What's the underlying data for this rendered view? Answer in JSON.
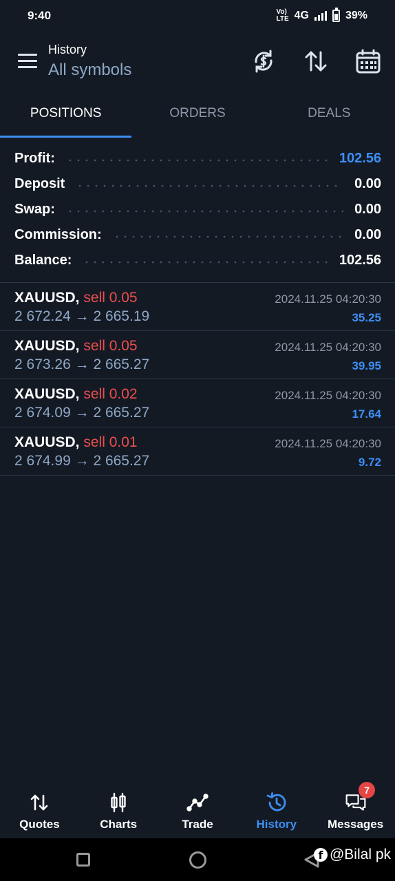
{
  "status_bar": {
    "time": "9:40",
    "volte": "VoLTE",
    "network": "4G",
    "battery": "39%"
  },
  "header": {
    "title": "History",
    "subtitle": "All symbols",
    "icons": [
      "currency-refresh-icon",
      "sort-icon",
      "calendar-icon"
    ]
  },
  "tabs": [
    {
      "label": "POSITIONS",
      "active": true
    },
    {
      "label": "ORDERS",
      "active": false
    },
    {
      "label": "DEALS",
      "active": false
    }
  ],
  "summary": [
    {
      "label": "Profit:",
      "value": "102.56",
      "highlight": true
    },
    {
      "label": "Deposit",
      "value": "0.00",
      "highlight": false
    },
    {
      "label": "Swap:",
      "value": "0.00",
      "highlight": false
    },
    {
      "label": "Commission:",
      "value": "0.00",
      "highlight": false
    },
    {
      "label": "Balance:",
      "value": "102.56",
      "highlight": false
    }
  ],
  "positions": [
    {
      "symbol": "XAUUSD,",
      "side": "sell 0.05",
      "open": "2 672.24",
      "arrow": "→",
      "close": "2 665.19",
      "time": "2024.11.25 04:20:30",
      "profit": "35.25"
    },
    {
      "symbol": "XAUUSD,",
      "side": "sell 0.05",
      "open": "2 673.26",
      "arrow": "→",
      "close": "2 665.27",
      "time": "2024.11.25 04:20:30",
      "profit": "39.95"
    },
    {
      "symbol": "XAUUSD,",
      "side": "sell 0.02",
      "open": "2 674.09",
      "arrow": "→",
      "close": "2 665.27",
      "time": "2024.11.25 04:20:30",
      "profit": "17.64"
    },
    {
      "symbol": "XAUUSD,",
      "side": "sell 0.01",
      "open": "2 674.99",
      "arrow": "→",
      "close": "2 665.27",
      "time": "2024.11.25 04:20:30",
      "profit": "9.72"
    }
  ],
  "bottom_nav": [
    {
      "label": "Quotes",
      "icon": "quotes-icon",
      "active": false
    },
    {
      "label": "Charts",
      "icon": "charts-icon",
      "active": false
    },
    {
      "label": "Trade",
      "icon": "trade-icon",
      "active": false
    },
    {
      "label": "History",
      "icon": "history-icon",
      "active": true
    },
    {
      "label": "Messages",
      "icon": "messages-icon",
      "active": false,
      "badge": "7"
    }
  ],
  "watermark": "@Bilal pk",
  "colors": {
    "background": "#131a24",
    "accent": "#3d8ff5",
    "sell": "#ee4e4e",
    "muted": "#8fa7c6"
  }
}
